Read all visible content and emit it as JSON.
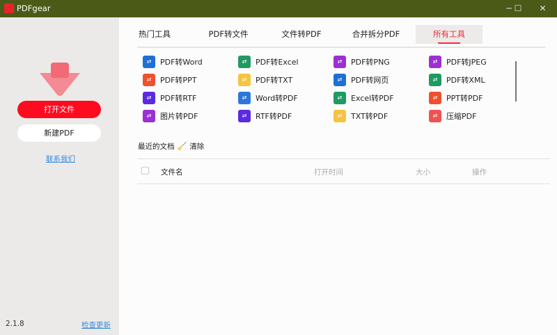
{
  "window": {
    "title": "PDFgear",
    "logo_text": "PDF",
    "minimize": "─",
    "maximize": "☐",
    "close": "✕"
  },
  "sidebar": {
    "open_file": "打开文件",
    "new_pdf": "新建PDF",
    "contact_us": "联系我们",
    "version": "2.1.8",
    "check_update": "检查更新"
  },
  "tabs": [
    {
      "label": "热门工具"
    },
    {
      "label": "PDF转文件"
    },
    {
      "label": "文件转PDF"
    },
    {
      "label": "合并拆分PDF"
    },
    {
      "label": "所有工具",
      "active": true
    }
  ],
  "tools": [
    {
      "label": "PDF转Word",
      "color": "#1e6fd6"
    },
    {
      "label": "PDF转Excel",
      "color": "#1f9a63"
    },
    {
      "label": "PDF转PNG",
      "color": "#9a2fd3"
    },
    {
      "label": "PDF转JPEG",
      "color": "#9a2fd3"
    },
    {
      "label": "PDF转PPT",
      "color": "#f0502e"
    },
    {
      "label": "PDF转TXT",
      "color": "#f5c441"
    },
    {
      "label": "PDF转网页",
      "color": "#1e6fd6"
    },
    {
      "label": "PDF转XML",
      "color": "#1f9a63"
    },
    {
      "label": "PDF转RTF",
      "color": "#5a2be0"
    },
    {
      "label": "Word转PDF",
      "color": "#2c78d8"
    },
    {
      "label": "Excel转PDF",
      "color": "#1f9a63"
    },
    {
      "label": "PPT转PDF",
      "color": "#f0502e"
    },
    {
      "label": "图片转PDF",
      "color": "#9a2fd3"
    },
    {
      "label": "RTF转PDF",
      "color": "#5a2be0"
    },
    {
      "label": "TXT转PDF",
      "color": "#f5c441"
    },
    {
      "label": "压缩PDF",
      "color": "#ef5350"
    }
  ],
  "recent": {
    "title": "最近的文档",
    "clear": "清除",
    "columns": {
      "name": "文件名",
      "opened": "打开时间",
      "size": "大小",
      "actions": "操作"
    }
  }
}
